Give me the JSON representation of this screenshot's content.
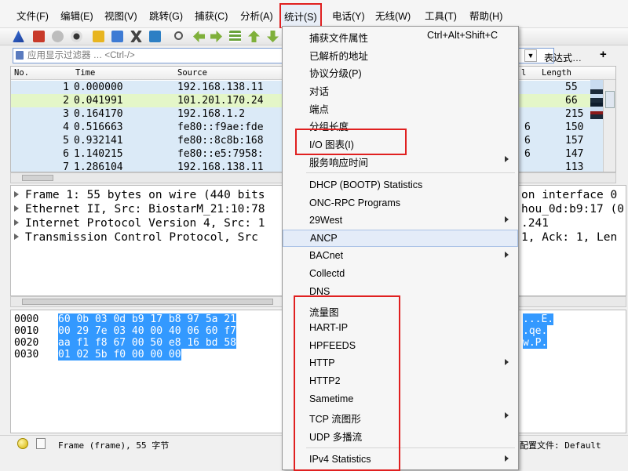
{
  "menubar": {
    "items": [
      "文件(F)",
      "编辑(E)",
      "视图(V)",
      "跳转(G)",
      "捕获(C)",
      "分析(A)",
      "统计(S)",
      "电话(Y)",
      "无线(W)",
      "工具(T)",
      "帮助(H)"
    ]
  },
  "filter": {
    "placeholder": "应用显示过滤器 … <Ctrl-/>",
    "expression_label": "表达式…",
    "add_label": "+"
  },
  "packet_list": {
    "columns": [
      "No.",
      "Time",
      "Source",
      "l",
      "Length"
    ],
    "rows": [
      {
        "no": "1",
        "time": "0.000000",
        "source": "192.168.138.11",
        "proto_tail": "",
        "length": "55"
      },
      {
        "no": "2",
        "time": "0.041991",
        "source": "101.201.170.24",
        "proto_tail": "",
        "length": "66"
      },
      {
        "no": "3",
        "time": "0.164170",
        "source": "192.168.1.2",
        "proto_tail": "",
        "length": "215"
      },
      {
        "no": "4",
        "time": "0.516663",
        "source": "fe80::f9ae:fde",
        "proto_tail": "6",
        "length": "150"
      },
      {
        "no": "5",
        "time": "0.932141",
        "source": "fe80::8c8b:168",
        "proto_tail": "6",
        "length": "157"
      },
      {
        "no": "6",
        "time": "1.140215",
        "source": "fe80::e5:7958:",
        "proto_tail": "6",
        "length": "147"
      },
      {
        "no": "7",
        "time": "1.286104",
        "source": "192.168.138.11",
        "proto_tail": "",
        "length": "113"
      }
    ],
    "row_colors": [
      "#dbeaf7",
      "#e4f6c8",
      "#dbeaf7",
      "#dbeaf7",
      "#dbeaf7",
      "#dbeaf7",
      "#dbeaf7"
    ]
  },
  "details": {
    "lines": [
      {
        "left": "Frame 1: 55 bytes on wire (440 bits",
        "right": "on interface 0"
      },
      {
        "left": "Ethernet II, Src: BiostarM_21:10:78",
        "right": "hou_0d:b9:17 (0"
      },
      {
        "left": "Internet Protocol Version 4, Src: 1",
        "right": ".241"
      },
      {
        "left": "Transmission Control Protocol, Src",
        "right": "1, Ack: 1, Len"
      }
    ]
  },
  "bytes": {
    "rows": [
      {
        "offset": "0000",
        "hex": "60 0b 03 0d b9 17 b8 97  5a 21",
        "ascii": "...E."
      },
      {
        "offset": "0010",
        "hex": "00 29 7e 03 40 00 40 06  60 f7",
        "ascii": ".qe."
      },
      {
        "offset": "0020",
        "hex": "aa f1 f8 67 00 50 e8 16  bd 58",
        "ascii": "w.P."
      },
      {
        "offset": "0030",
        "hex": "01 02 5b f0 00 00 00",
        "ascii": ""
      }
    ]
  },
  "status": {
    "frame_text": "Frame (frame), 55 字节",
    "profile_text": "配置文件: Default"
  },
  "stats_menu": {
    "items": [
      {
        "label": "捕获文件属性",
        "shortcut": "Ctrl+Alt+Shift+C",
        "submenu": false
      },
      {
        "label": "已解析的地址",
        "shortcut": "",
        "submenu": false
      },
      {
        "label": "协议分级(P)",
        "shortcut": "",
        "submenu": false
      },
      {
        "label": "对话",
        "shortcut": "",
        "submenu": false
      },
      {
        "label": "端点",
        "shortcut": "",
        "submenu": false
      },
      {
        "label": "分组长度",
        "shortcut": "",
        "submenu": false
      },
      {
        "label": "I/O 图表(I)",
        "shortcut": "",
        "submenu": false
      },
      {
        "label": "服务响应时间",
        "shortcut": "",
        "submenu": true
      },
      {
        "label": "DHCP (BOOTP) Statistics",
        "shortcut": "",
        "submenu": false
      },
      {
        "label": "ONC-RPC Programs",
        "shortcut": "",
        "submenu": false
      },
      {
        "label": "29West",
        "shortcut": "",
        "submenu": true
      },
      {
        "label": "ANCP",
        "shortcut": "",
        "submenu": false
      },
      {
        "label": "BACnet",
        "shortcut": "",
        "submenu": true
      },
      {
        "label": "Collectd",
        "shortcut": "",
        "submenu": false
      },
      {
        "label": "DNS",
        "shortcut": "",
        "submenu": false
      },
      {
        "label": "流量图",
        "shortcut": "",
        "submenu": false
      },
      {
        "label": "HART-IP",
        "shortcut": "",
        "submenu": false
      },
      {
        "label": "HPFEEDS",
        "shortcut": "",
        "submenu": false
      },
      {
        "label": "HTTP",
        "shortcut": "",
        "submenu": true
      },
      {
        "label": "HTTP2",
        "shortcut": "",
        "submenu": false
      },
      {
        "label": "Sametime",
        "shortcut": "",
        "submenu": false
      },
      {
        "label": "TCP 流图形",
        "shortcut": "",
        "submenu": true
      },
      {
        "label": "UDP 多播流",
        "shortcut": "",
        "submenu": false
      },
      {
        "label": "IPv4 Statistics",
        "shortcut": "",
        "submenu": true
      }
    ]
  },
  "colors": {
    "highlight_red": "#e02020",
    "selection_blue": "#3399ff"
  }
}
